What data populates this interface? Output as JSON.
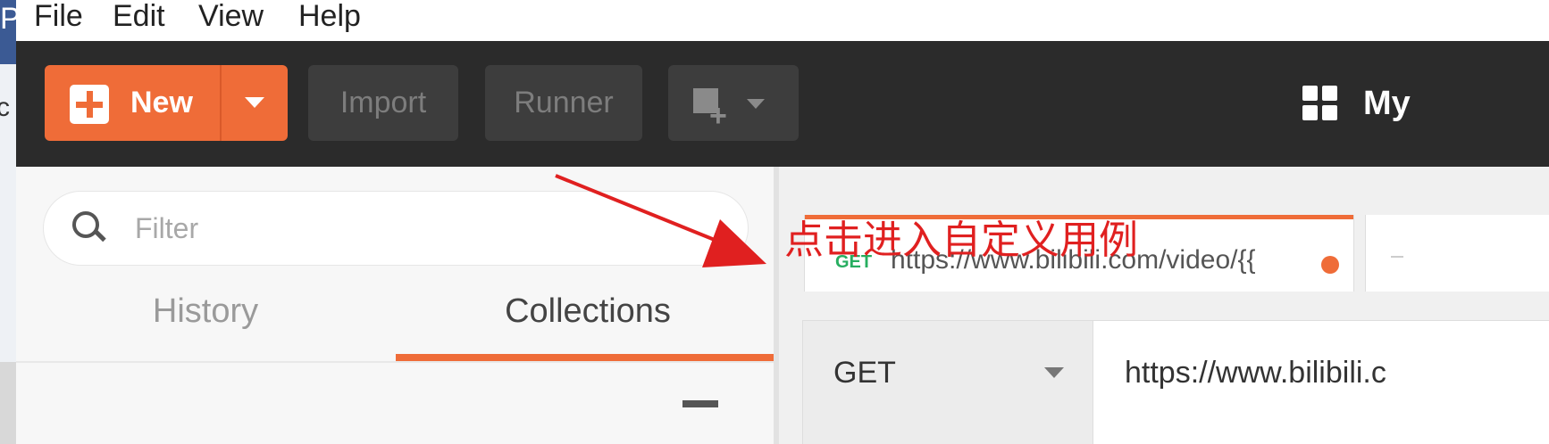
{
  "menu": {
    "file": "File",
    "edit": "Edit",
    "view": "View",
    "help": "Help"
  },
  "header": {
    "new_label": "New",
    "import_label": "Import",
    "runner_label": "Runner",
    "workspace_label": "My"
  },
  "sidebar": {
    "filter_placeholder": "Filter",
    "tabs": [
      {
        "label": "History",
        "active": false
      },
      {
        "label": "Collections",
        "active": true
      }
    ]
  },
  "request_tab": {
    "method": "GET",
    "url": "https://www.bilibili.com/video/{{",
    "unsaved": true
  },
  "request": {
    "method": "GET",
    "url": "https://www.bilibili.c"
  },
  "annotation": {
    "text": "点击进入自定义用例",
    "color": "#e02020"
  },
  "colors": {
    "accent": "#ef6c38",
    "header_bg": "#2b2b2b",
    "get_method": "#27ae60"
  }
}
